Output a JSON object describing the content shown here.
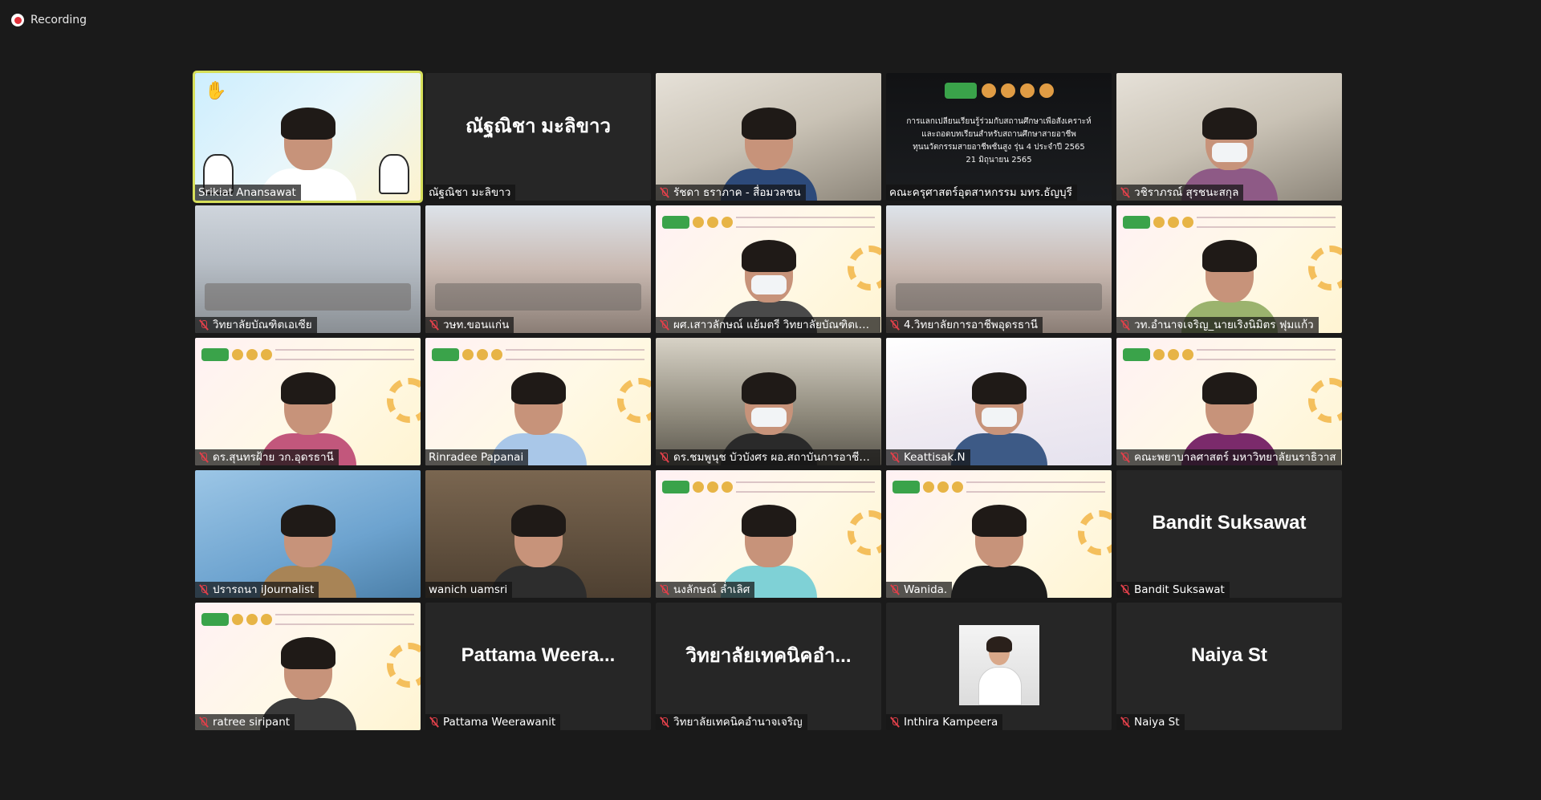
{
  "recording": {
    "label": "Recording"
  },
  "tiles": [
    {
      "name": "Srikiat Anansawat",
      "mic_muted": false,
      "active": true,
      "kind": "video",
      "bg": "bg-kids",
      "shirt": "#ffffff"
    },
    {
      "name": "ณัฐณิชา มะลิขาว",
      "mic_muted": false,
      "active": false,
      "kind": "name",
      "display_name": "ณัฐณิชา มะลิขาว"
    },
    {
      "name": "รัชดา ธราภาค - สื่อมวลชน",
      "mic_muted": true,
      "active": false,
      "kind": "video",
      "bg": "bg-office",
      "shirt": "#2d4a7a"
    },
    {
      "name": "คณะครุศาสตร์อุตสาหกรรม มทร.ธัญบุรี",
      "mic_muted": false,
      "active": false,
      "kind": "cert",
      "cert_lines": [
        "การแลกเปลี่ยนเรียนรู้ร่วมกับสถานศึกษาเพื่อสังเคราะห์",
        "และถอดบทเรียนสำหรับสถานศึกษาสายอาชีพ",
        "ทุนนวัตกรรมสายอาชีพชั้นสูง รุ่น 4 ประจำปี 2565",
        "21 มิถุนายน 2565"
      ]
    },
    {
      "name": "วชิราภรณ์ สุรชนะสกุล",
      "mic_muted": true,
      "active": false,
      "kind": "video",
      "bg": "bg-office",
      "shirt": "#8e5a86",
      "mask": true
    },
    {
      "name": "วิทยาลัยบัณฑิตเอเซีย",
      "mic_muted": true,
      "active": false,
      "kind": "room",
      "bg": "bg-room"
    },
    {
      "name": "วษท.ขอนแก่น",
      "mic_muted": true,
      "active": false,
      "kind": "room",
      "bg": "bg-hall"
    },
    {
      "name": "ผศ.เสาวลักษณ์ แย้มตรี วิทยาลัยบัณฑิตเอเซีย",
      "mic_muted": true,
      "active": false,
      "kind": "slide",
      "shirt": "#4a4a4a",
      "mask": true
    },
    {
      "name": "4.วิทยาลัยการอาชีพอุดรธานี",
      "mic_muted": true,
      "active": false,
      "kind": "room",
      "bg": "bg-hall"
    },
    {
      "name": "วท.อำนาจเจริญ_นายเริงนิมิตร ฟุมแก้ว",
      "mic_muted": true,
      "active": false,
      "kind": "slide",
      "shirt": "#9bb36e"
    },
    {
      "name": "ดร.สุนทรฝ้าย วก.อุดรธานี",
      "mic_muted": true,
      "active": false,
      "kind": "slide",
      "shirt": "#c2577c"
    },
    {
      "name": "Rinradee Papanai",
      "mic_muted": false,
      "active": false,
      "kind": "slide",
      "shirt": "#a9c7e8"
    },
    {
      "name": "ดร.ชมพูนุช บัวบังศร ผอ.สถาบันการอาชีวศึกษากรุงเทพมหานคร",
      "mic_muted": true,
      "active": false,
      "kind": "video",
      "bg": "bg-flag",
      "shirt": "#2a2a2a",
      "mask": true
    },
    {
      "name": "Keattisak.N",
      "mic_muted": true,
      "active": false,
      "kind": "video",
      "bg": "bg-wave",
      "shirt": "#3d5a86",
      "mask": true
    },
    {
      "name": "คณะพยาบาลศาสตร์ มหาวิทยาลัยนราธิวาส",
      "mic_muted": true,
      "active": false,
      "kind": "slide",
      "shirt": "#7b2a6b"
    },
    {
      "name": "ปรารถนา iJournalist",
      "mic_muted": true,
      "active": false,
      "kind": "video",
      "bg": "bg-blue",
      "shirt": "#a88456"
    },
    {
      "name": "wanich uamsri",
      "mic_muted": false,
      "active": false,
      "kind": "video",
      "bg": "bg-book",
      "shirt": "#2d2d2d"
    },
    {
      "name": "นงลักษณ์ ล่ำเลิศ",
      "mic_muted": true,
      "active": false,
      "kind": "slide",
      "shirt": "#7fd1d6"
    },
    {
      "name": "Wanida.",
      "mic_muted": true,
      "active": false,
      "kind": "slide",
      "shirt": "#1c1c1c"
    },
    {
      "name": "Bandit Suksawat",
      "mic_muted": true,
      "active": false,
      "kind": "name",
      "display_name": "Bandit Suksawat"
    },
    {
      "name": "ratree siripant",
      "mic_muted": true,
      "active": false,
      "kind": "slide",
      "shirt": "#3a3a3a"
    },
    {
      "name": "Pattama Weerawanit",
      "mic_muted": true,
      "active": false,
      "kind": "name",
      "display_name": "Pattama  Weera..."
    },
    {
      "name": "วิทยาลัยเทคนิคอำนาจเจริญ",
      "mic_muted": true,
      "active": false,
      "kind": "name",
      "display_name": "วิทยาลัยเทคนิคอำ..."
    },
    {
      "name": "Inthira Kampeera",
      "mic_muted": true,
      "active": false,
      "kind": "photo"
    },
    {
      "name": "Naiya St",
      "mic_muted": true,
      "active": false,
      "kind": "name",
      "display_name": "Naiya St"
    }
  ]
}
